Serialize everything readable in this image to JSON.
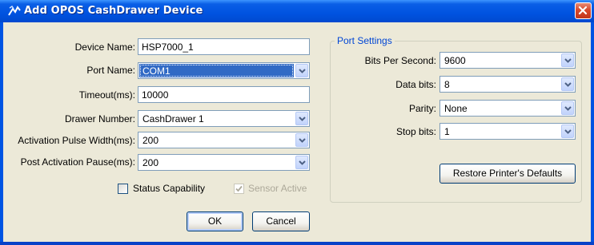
{
  "window": {
    "title": "Add OPOS CashDrawer Device",
    "icon": "app-icon",
    "close_icon": "close-icon"
  },
  "device": {
    "device_name_label": "Device Name:",
    "device_name_value": "HSP7000_1",
    "port_name_label": "Port Name:",
    "port_name_value": "COM1",
    "timeout_label": "Timeout(ms):",
    "timeout_value": "10000",
    "drawer_number_label": "Drawer Number:",
    "drawer_number_value": "CashDrawer 1",
    "pulse_width_label": "Activation Pulse Width(ms):",
    "pulse_width_value": "200",
    "post_pause_label": "Post Activation Pause(ms):",
    "post_pause_value": "200"
  },
  "checks": {
    "status_capability_label": "Status Capability",
    "status_capability_checked": false,
    "sensor_active_label": "Sensor Active",
    "sensor_active_checked": true
  },
  "port_settings": {
    "title": "Port Settings",
    "bits_per_second_label": "Bits Per Second:",
    "bits_per_second_value": "9600",
    "data_bits_label": "Data bits:",
    "data_bits_value": "8",
    "parity_label": "Parity:",
    "parity_value": "None",
    "stop_bits_label": "Stop bits:",
    "stop_bits_value": "1",
    "restore_label": "Restore Printer's Defaults"
  },
  "buttons": {
    "ok_label": "OK",
    "cancel_label": "Cancel"
  },
  "colors": {
    "titlebar": "#0054e3",
    "dialog_bg": "#ece9d8",
    "selection": "#316ac5",
    "groupbox_title": "#0046d5"
  }
}
